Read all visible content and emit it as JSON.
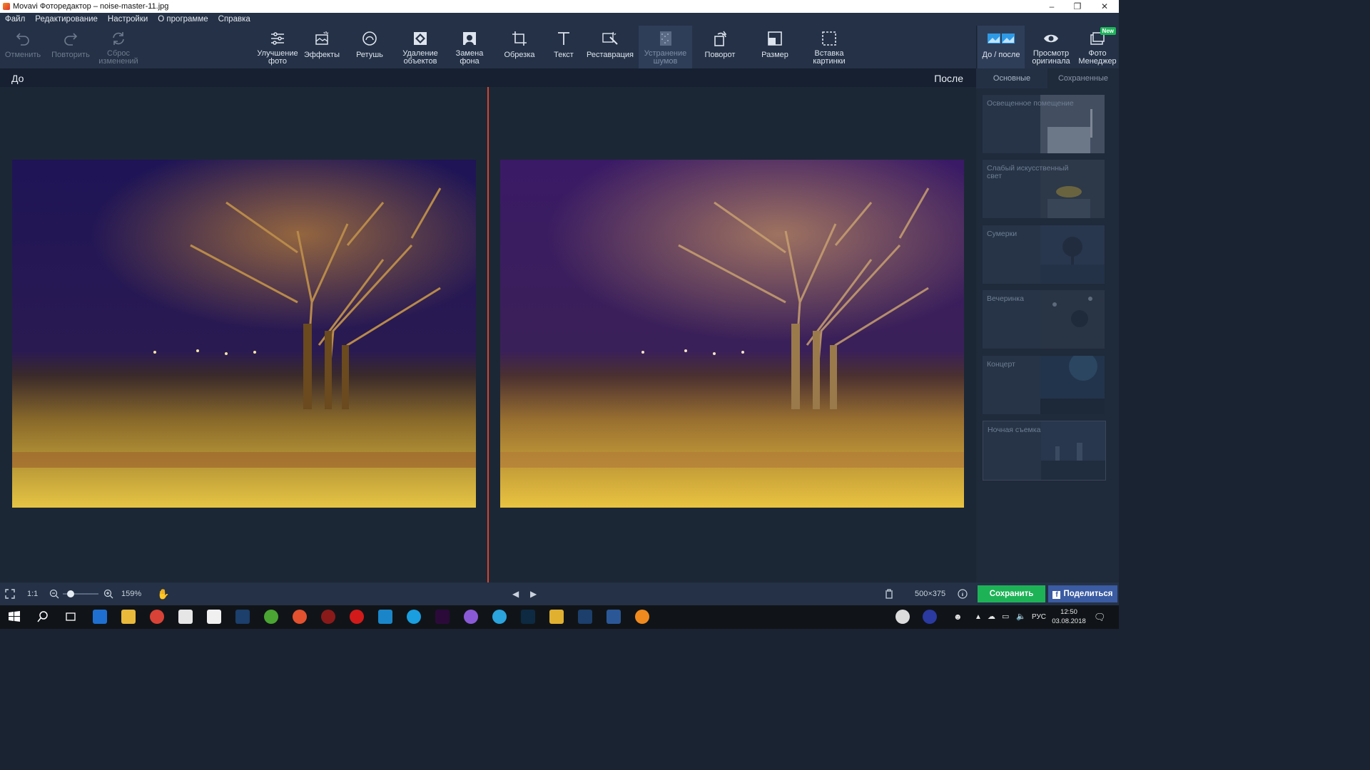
{
  "window": {
    "title": "Movavi Фоторедактор – noise-master-11.jpg",
    "controls": [
      "–",
      "❐",
      "✕"
    ]
  },
  "menu": [
    "Файл",
    "Редактирование",
    "Настройки",
    "О программе",
    "Справка"
  ],
  "toolbar": {
    "undo": "Отменить",
    "redo": "Повторить",
    "reset": "Сброс изменений",
    "enhance": "Улучшение фото",
    "effects": "Эффекты",
    "retouch": "Ретушь",
    "object_removal": "Удаление объектов",
    "bg_replace": "Замена фона",
    "crop": "Обрезка",
    "text": "Текст",
    "restoration": "Реставрация",
    "denoise": "Устранение шумов",
    "rotate": "Поворот",
    "resize": "Размер",
    "insert_image": "Вставка картинки",
    "before_after": "До / после",
    "view_original": "Просмотр оригинала",
    "photo_manager": "Фото Менеджер",
    "new_badge": "New"
  },
  "compare": {
    "before_label": "До",
    "after_label": "После"
  },
  "panel": {
    "tabs": [
      "Основные",
      "Сохраненные"
    ],
    "presets": [
      "Освещенное помещение",
      "Слабый искусственный свет",
      "Сумерки",
      "Вечеринка",
      "Концерт",
      "Ночная съемка"
    ]
  },
  "statusbar": {
    "fit_icon": "fullscreen-icon",
    "ratio": "1:1",
    "zoom": "159%",
    "zoom_level": 0.2,
    "dimensions": "500×375",
    "save": "Сохранить",
    "share": "Поделиться"
  },
  "taskbar": {
    "lang": "РУС",
    "time": "12:50",
    "date": "03.08.2018"
  },
  "colors": {
    "accent": "#1eb257",
    "share": "#3b5ba2",
    "divider": "#d9432f",
    "bg": "#1c2736"
  }
}
